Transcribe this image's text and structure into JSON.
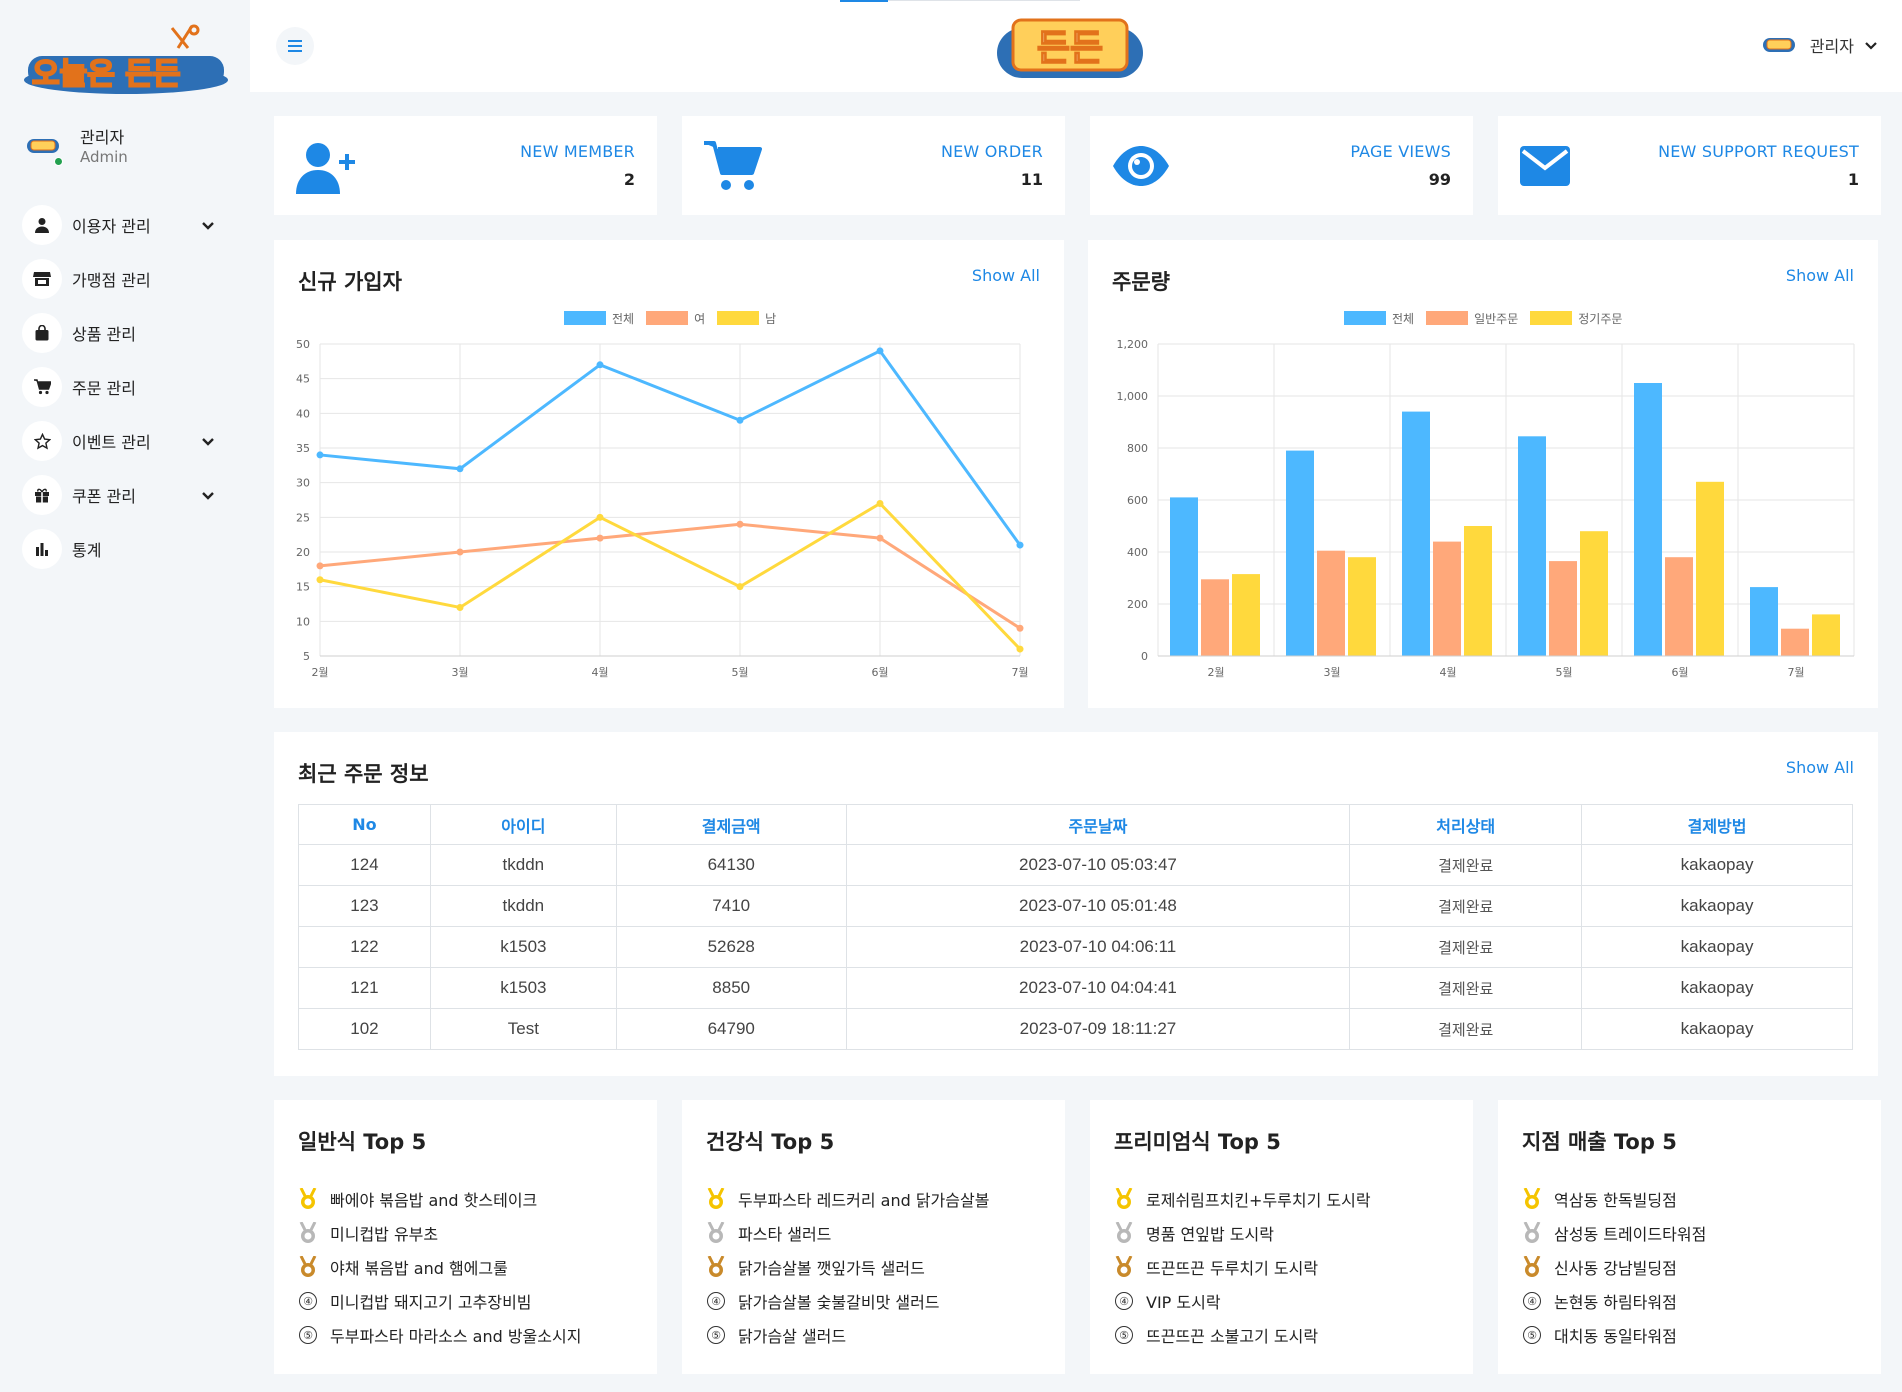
{
  "colors": {
    "accent": "#1e88e5",
    "blue": "#4db8ff",
    "orange": "#ffa87a",
    "yellow": "#ffd93d",
    "online": "#22a04f"
  },
  "sidebar": {
    "logo_text": "오늘은 든든",
    "user": {
      "name": "관리자",
      "role": "Admin"
    },
    "items": [
      {
        "label": "이용자 관리",
        "icon": "user-icon",
        "has_submenu": true
      },
      {
        "label": "가맹점 관리",
        "icon": "store-icon",
        "has_submenu": false
      },
      {
        "label": "상품 관리",
        "icon": "shopping-bag-icon",
        "has_submenu": false
      },
      {
        "label": "주문 관리",
        "icon": "cart-icon",
        "has_submenu": false
      },
      {
        "label": "이벤트 관리",
        "icon": "star-icon",
        "has_submenu": true
      },
      {
        "label": "쿠폰 관리",
        "icon": "gift-icon",
        "has_submenu": true
      },
      {
        "label": "통계",
        "icon": "bar-chart-icon",
        "has_submenu": false
      }
    ]
  },
  "topbar": {
    "logo_text": "든든",
    "user_name": "관리자"
  },
  "stats": [
    {
      "label": "NEW MEMBER",
      "value": "2",
      "icon": "user-plus-icon"
    },
    {
      "label": "NEW ORDER",
      "value": "11",
      "icon": "cart-icon"
    },
    {
      "label": "PAGE VIEWS",
      "value": "99",
      "icon": "eye-icon"
    },
    {
      "label": "NEW SUPPORT REQUEST",
      "value": "1",
      "icon": "envelope-icon"
    }
  ],
  "show_all": "Show All",
  "chart_data": [
    {
      "type": "line",
      "title": "신규 가입자",
      "categories": [
        "2월",
        "3월",
        "4월",
        "5월",
        "6월",
        "7월"
      ],
      "series": [
        {
          "name": "전체",
          "values": [
            34,
            32,
            47,
            39,
            49,
            21
          ]
        },
        {
          "name": "여",
          "values": [
            18,
            20,
            22,
            24,
            22,
            9
          ]
        },
        {
          "name": "남",
          "values": [
            16,
            12,
            25,
            15,
            27,
            6
          ]
        }
      ],
      "ylim": [
        5,
        50
      ],
      "yticks": [
        5,
        10,
        15,
        20,
        25,
        30,
        35,
        40,
        45,
        50
      ],
      "grid": true,
      "legend": "top-center"
    },
    {
      "type": "bar",
      "title": "주문량",
      "categories": [
        "2월",
        "3월",
        "4월",
        "5월",
        "6월",
        "7월"
      ],
      "series": [
        {
          "name": "전체",
          "values": [
            610,
            790,
            940,
            845,
            1050,
            265
          ]
        },
        {
          "name": "일반주문",
          "values": [
            295,
            405,
            440,
            365,
            380,
            105
          ]
        },
        {
          "name": "정기주문",
          "values": [
            315,
            380,
            500,
            480,
            670,
            160
          ]
        }
      ],
      "ylim": [
        0,
        1200
      ],
      "yticks": [
        "0",
        "200",
        "400",
        "600",
        "800",
        "1,000",
        "1,200"
      ],
      "grid": true,
      "legend": "top-center"
    }
  ],
  "orders": {
    "title": "최근 주문 정보",
    "columns": [
      "No",
      "아이디",
      "결제금액",
      "주문날짜",
      "처리상태",
      "결제방법"
    ],
    "rows": [
      [
        "124",
        "tkddn",
        "64130",
        "2023-07-10 05:03:47",
        "결제완료",
        "kakaopay"
      ],
      [
        "123",
        "tkddn",
        "7410",
        "2023-07-10 05:01:48",
        "결제완료",
        "kakaopay"
      ],
      [
        "122",
        "k1503",
        "52628",
        "2023-07-10 04:06:11",
        "결제완료",
        "kakaopay"
      ],
      [
        "121",
        "k1503",
        "8850",
        "2023-07-10 04:04:41",
        "결제완료",
        "kakaopay"
      ],
      [
        "102",
        "Test",
        "64790",
        "2023-07-09 18:11:27",
        "결제완료",
        "kakaopay"
      ]
    ]
  },
  "top5": [
    {
      "title": "일반식 Top 5",
      "items": [
        "빠에야 볶음밥 and 핫스테이크",
        "미니컵밥 유부초",
        "야채 볶음밥 and 햄에그룰",
        "미니컵밥 돼지고기 고추장비빔",
        "두부파스타 마라소스 and 방울소시지"
      ]
    },
    {
      "title": "건강식 Top 5",
      "items": [
        "두부파스타 레드커리 and 닭가슴살볼",
        "파스타 샐러드",
        "닭가슴살볼 깻잎가득 샐러드",
        "닭가슴살볼 숯불갈비맛 샐러드",
        "닭가슴살 샐러드"
      ]
    },
    {
      "title": "프리미엄식 Top 5",
      "items": [
        "로제쉬림프치킨+두루치기 도시락",
        "명품 연잎밥 도시락",
        "뜨끈뜨끈 두루치기 도시락",
        "VIP 도시락",
        "뜨끈뜨끈 소불고기 도시락"
      ]
    },
    {
      "title": "지점 매출 Top 5",
      "items": [
        "역삼동 한독빌딩점",
        "삼성동 트레이드타워점",
        "신사동 강남빌딩점",
        "논현동 하림타워점",
        "대치동 동일타워점"
      ]
    }
  ],
  "rank_labels": [
    "④",
    "⑤"
  ]
}
